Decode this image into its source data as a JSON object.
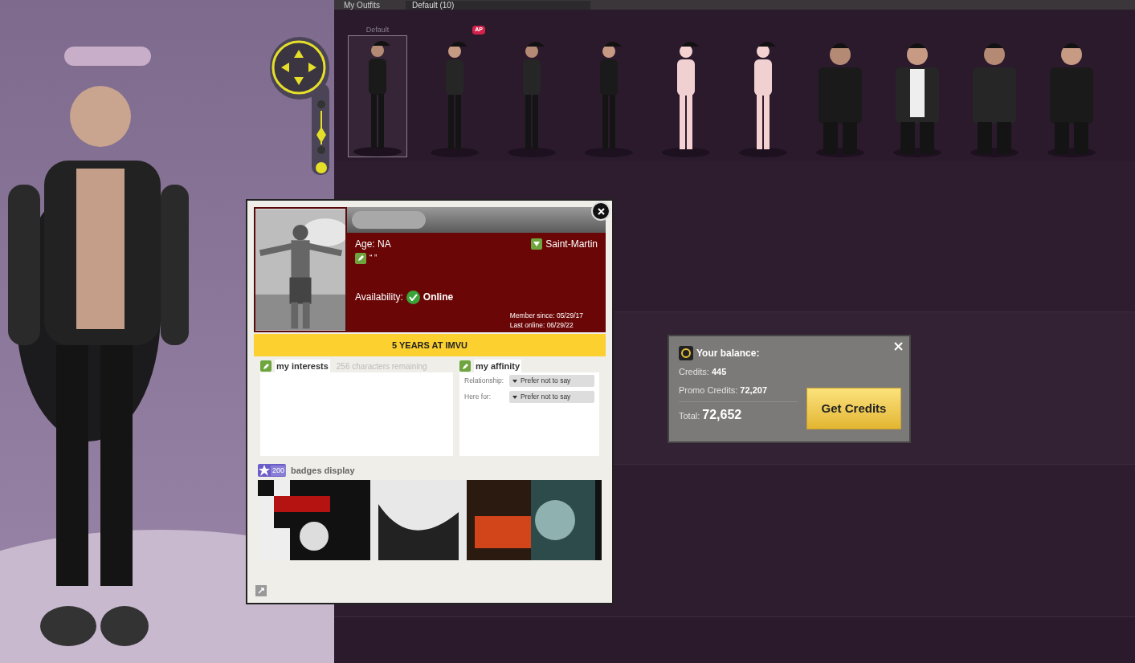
{
  "top_bar": {
    "title": "My Outfits",
    "dropdown": "Default (10)"
  },
  "outfits": [
    {
      "label": "Default",
      "selected": true
    },
    {
      "selected": false,
      "badge": "AP"
    },
    {
      "selected": false
    },
    {
      "selected": false
    },
    {
      "selected": false
    },
    {
      "selected": false
    },
    {
      "selected": false
    },
    {
      "selected": false
    },
    {
      "selected": false
    },
    {
      "selected": false
    }
  ],
  "profile": {
    "age": "Age: NA",
    "location": "Saint-Martin",
    "tagline": "“ ”",
    "availability_label": "Availability:",
    "status": "Online",
    "member_since": "Member since: 05/29/17",
    "last_online": "Last online: 06/29/22",
    "banner": "5 YEARS AT IMVU",
    "interests": {
      "title": "my interests",
      "remaining": "256 characters remaining"
    },
    "affinity": {
      "title": "my affinity",
      "fields": [
        {
          "label": "Relationship:",
          "value": "Prefer not to say"
        },
        {
          "label": "Here for:",
          "value": "Prefer not to say"
        }
      ]
    },
    "badges": {
      "count": "200",
      "title": "badges display"
    }
  },
  "balance": {
    "title": "Your balance:",
    "credits_label": "Credits:",
    "credits": "445",
    "promo_label": "Promo Credits:",
    "promo": "72,207",
    "total_label": "Total:",
    "total": "72,652",
    "button": "Get Credits"
  }
}
